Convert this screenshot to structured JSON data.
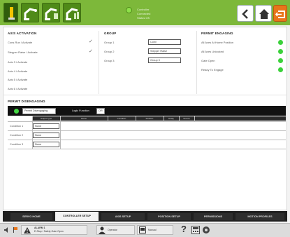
{
  "header": {
    "status_lines": [
      "Controller",
      "Connected",
      "Status OK"
    ],
    "colors": {
      "bar": "#7db83a",
      "accent": "#e8751a"
    },
    "icons": [
      "robot-arm-icon",
      "robot-mode-2-icon",
      "robot-mode-3-icon",
      "robot-mode-4-icon",
      "back-arrow-icon",
      "home-icon",
      "exit-icon"
    ]
  },
  "axis_activation": {
    "title": "AXIS ACTIVATION",
    "rows": [
      {
        "label": "Cons Run / Activate",
        "checked": true
      },
      {
        "label": "Stepper Raise / Activate",
        "checked": true
      },
      {
        "label": "Axis 3 / Activate",
        "checked": false
      },
      {
        "label": "Axis 4 / Activate",
        "checked": false
      },
      {
        "label": "Axis 5 / Activate",
        "checked": false
      },
      {
        "label": "Axis 6 / Activate",
        "checked": false
      }
    ]
  },
  "group": {
    "title": "GROUP",
    "rows": [
      {
        "label": "Group 1",
        "value": "Conv"
      },
      {
        "label": "Group 2",
        "value": "Stepper Raise"
      },
      {
        "label": "Group 3",
        "value": "Group 3"
      }
    ]
  },
  "permit_engaging": {
    "title": "PERMIT ENGAGING",
    "rows": [
      {
        "label": "All Axes At Home Position",
        "status": "on"
      },
      {
        "label": "All Axes Unlocked",
        "status": "on"
      },
      {
        "label": "Gate Open",
        "status": "on"
      },
      {
        "label": "Ready To Engage",
        "status": "on"
      }
    ]
  },
  "permit_disengaging": {
    "title": "PERMIT DISENGAGING",
    "mode_value": "Permit Disengaging",
    "logic_label": "Logic Function",
    "logic_value": "OR",
    "columns": [
      "Output Type",
      "Name",
      "Condition",
      "Position",
      "Delay",
      "Source"
    ],
    "rows": [
      {
        "name": "Condition 1",
        "type": "None"
      },
      {
        "name": "Condition 2",
        "type": "None"
      },
      {
        "name": "Condition 3",
        "type": "None"
      }
    ]
  },
  "tabs": [
    {
      "label": "SERVO HOME",
      "active": false
    },
    {
      "label": "CONTROLLER SETUP",
      "active": true
    },
    {
      "label": "AXIS SETUP",
      "active": false
    },
    {
      "label": "POSITION SETUP",
      "active": false
    },
    {
      "label": "PERMISSIONS",
      "active": false
    },
    {
      "label": "MOTION PROFILES",
      "active": false
    }
  ],
  "statusbar": {
    "alarm_text_1": "ALARM 1",
    "alarm_text_2": "E-Stop / Safety Gate Open",
    "user_text": "Operator",
    "mode_text": "Manual",
    "help_label": "?"
  }
}
